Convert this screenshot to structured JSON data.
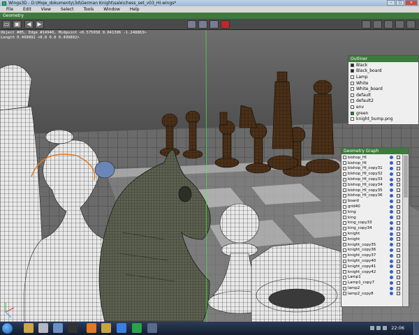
{
  "window": {
    "title": "Wings3D - D:\\Moje_dokumenty\\3d\\German Knight\\sale\\chess_set_v03_HI.wings*"
  },
  "menu": [
    "File",
    "Edit",
    "View",
    "Select",
    "Tools",
    "Window",
    "Help"
  ],
  "geometry_window": {
    "label": "Geometry"
  },
  "info": {
    "line1": "Object #85, Edge #14940, Midpoint <0.575038  0.041306  -1.248863>",
    "line2": "Length 0.499892  <0.0  0.0  0.499892>"
  },
  "outliner": {
    "title": "Outliner",
    "items": [
      {
        "label": "Black",
        "swatch": "dark"
      },
      {
        "label": "Black_board",
        "swatch": "dark"
      },
      {
        "label": "Lamp",
        "swatch": "light"
      },
      {
        "label": "White",
        "swatch": "light"
      },
      {
        "label": "White_board",
        "swatch": "light"
      },
      {
        "label": "default",
        "swatch": "light"
      },
      {
        "label": "default2",
        "swatch": "light"
      },
      {
        "label": "env",
        "swatch": "light"
      },
      {
        "label": "green",
        "swatch": "green"
      },
      {
        "label": "knight_bump.png",
        "swatch": "light"
      }
    ]
  },
  "geometry_graph": {
    "title": "Geometry Graph",
    "items": [
      "bishop_HI",
      "bishop_HI",
      "bishop_HI_copy31",
      "bishop_HI_copy32",
      "bishop_HI_copy33",
      "bishop_HI_copy34",
      "bishop_HI_copy35",
      "bishop_HI_copy36",
      "board",
      "grid40",
      "king",
      "king",
      "king_copy33",
      "king_copy34",
      "knight",
      "knight",
      "knight_copy35",
      "knight_copy36",
      "knight_copy37",
      "knight_copy40",
      "knight_copy41",
      "knight_copy42",
      "Lamp1",
      "Lamp1_copy7",
      "lamp2",
      "lamp2_copy8"
    ]
  },
  "taskbar": {
    "clock": "22:06"
  },
  "colors": {
    "panel_header": "#3d7a3d",
    "active_selection": "#c0272d",
    "wood_dark": "#3b2512",
    "wood_light": "#6b4420"
  }
}
